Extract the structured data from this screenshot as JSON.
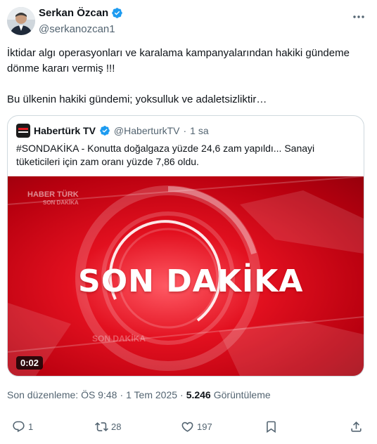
{
  "author": {
    "name": "Serkan Özcan",
    "handle": "@serkanozcan1",
    "verified": true
  },
  "tweet": {
    "text": "İktidar algı operasyonları ve karalama kampanyalarından hakiki gündeme dönme kararı vermiş !!!\n\nBu ülkenin hakiki gündemi; yoksulluk ve adaletsizliktir…"
  },
  "quote": {
    "name": "Habertürk TV",
    "handle": "@HaberturkTV",
    "separator": "·",
    "time": "1 sa",
    "text": "#SONDAKİKA - Konutta doğalgaza yüzde 24,6 zam yapıldı... Sanayi tüketicileri için zam oranı yüzde 7,86 oldu.",
    "media": {
      "headline": "SON DAKİKA",
      "watermark_top": "HABER TÜRK",
      "watermark_sub": "SON DAKİKA",
      "faint_label": "SON DAKİKA",
      "duration": "0:02"
    }
  },
  "meta": {
    "edited_label": "Son düzenleme: ÖS 9:48",
    "separator": "·",
    "date": "1 Tem 2025",
    "views_count": "5.246",
    "views_label": "Görüntüleme"
  },
  "actions": {
    "replies": "1",
    "retweets": "28",
    "likes": "197"
  },
  "colors": {
    "verified": "#1d9bf0",
    "secondary_text": "#536471",
    "media_red": "#e2101f"
  }
}
